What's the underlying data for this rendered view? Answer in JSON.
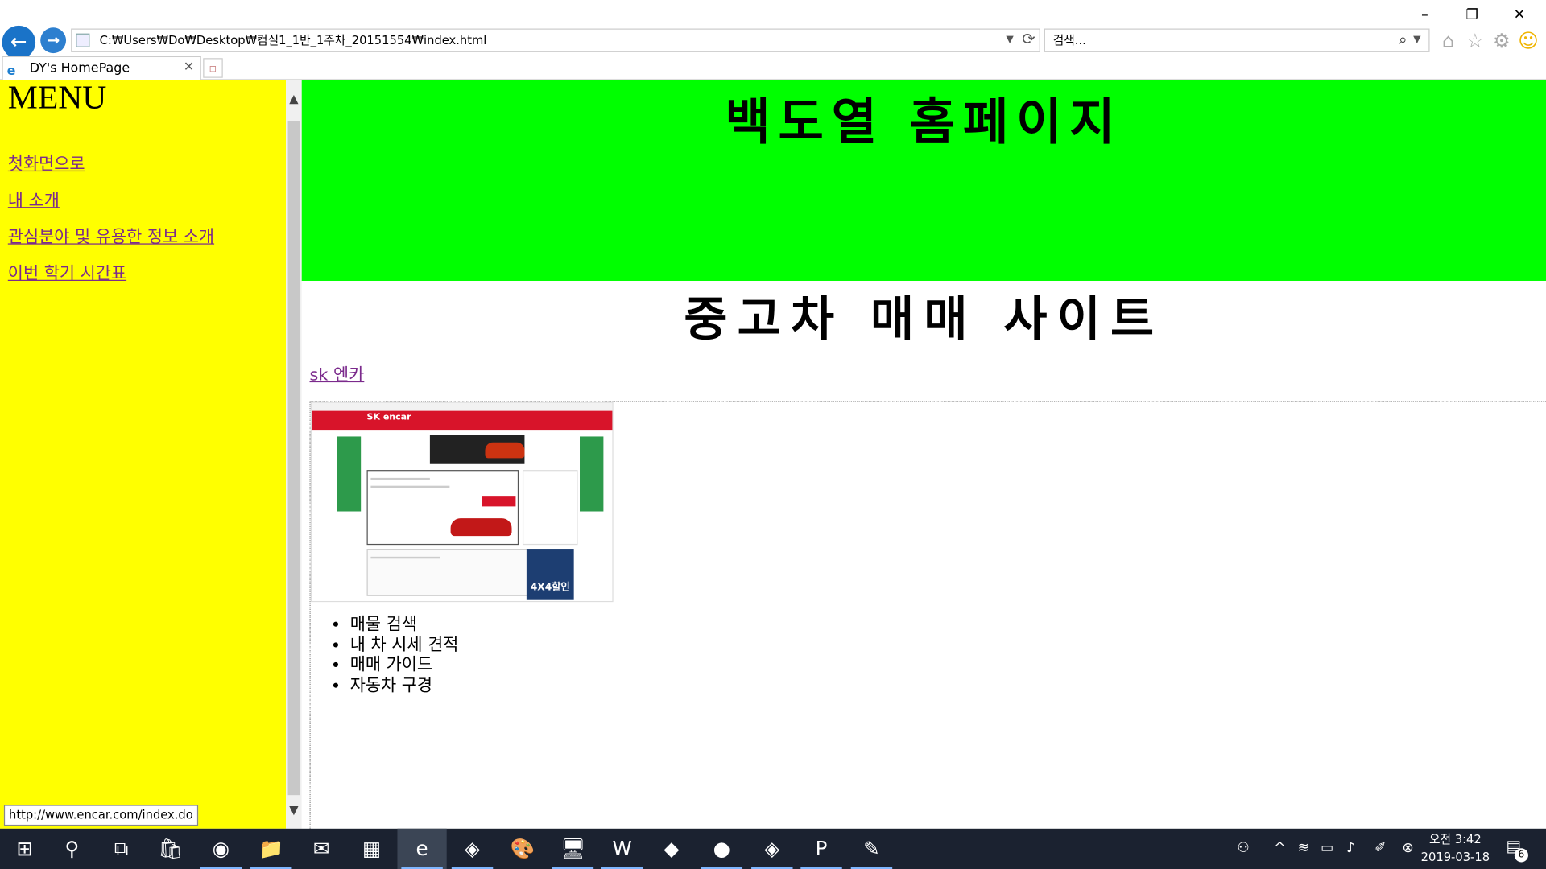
{
  "window": {
    "minimize": "–",
    "restore": "❐",
    "close": "✕"
  },
  "browser": {
    "address": "C:₩Users₩Do₩Desktop₩컴실1_1반_1주차_20151554₩index.html",
    "search_placeholder": "검색...",
    "tab_title": "DY's HomePage"
  },
  "menu": {
    "title": "MENU",
    "items": [
      {
        "label": "첫화면으로"
      },
      {
        "label": "내 소개"
      },
      {
        "label": "관심분야 및 유용한 정보 소개"
      },
      {
        "label": "이번 학기 시간표"
      }
    ]
  },
  "main": {
    "banner_title": "백도열 홈페이지",
    "subtitle": "중고차 매매 사이트",
    "site_link": "sk 엔카",
    "features": [
      "매물 검색",
      "내 차 시세 견적",
      "매매 가이드",
      "자동차 구경"
    ]
  },
  "preview": {
    "logo": "SK encar",
    "blue_banner": "4X4할인"
  },
  "status_url": "http://www.encar.com/index.do",
  "taskbar": {
    "time": "오전 3:42",
    "date": "2019-03-18",
    "notifications": "6"
  }
}
